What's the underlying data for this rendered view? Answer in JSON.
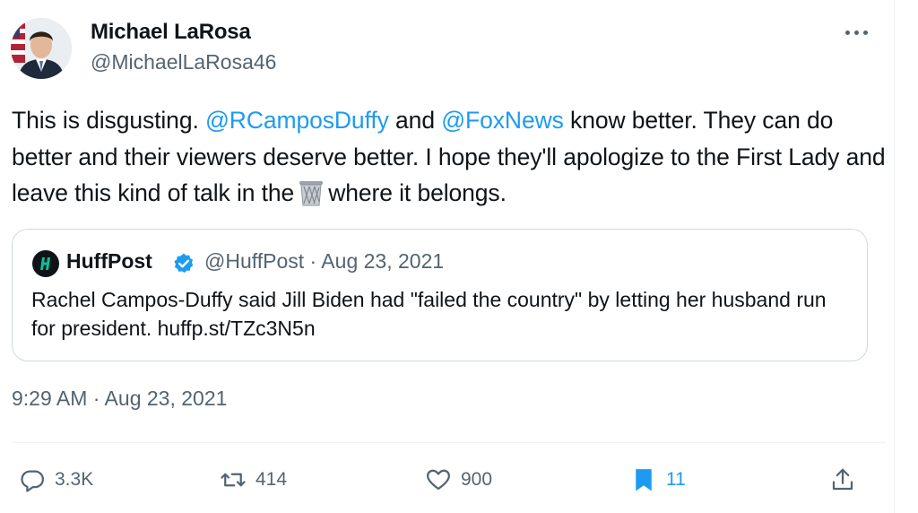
{
  "author": {
    "display_name": "Michael LaRosa",
    "handle": "@MichaelLaRosa46"
  },
  "tweet": {
    "text_1": "This is disgusting. ",
    "mention_1": "@RCamposDuffy",
    "text_2": " and ",
    "mention_2": "@FoxNews",
    "text_3": " know better. They can do better and their viewers deserve better. I hope they'll apologize to the First Lady and leave this kind of talk in the",
    "emoji_name": "wastebasket-emoji",
    "text_4": "where it belongs."
  },
  "quoted_tweet": {
    "author_name": "HuffPost",
    "handle_date": "@HuffPost · Aug 23, 2021",
    "text": "Rachel Campos-Duffy said Jill Biden had \"failed the country\" by letting her husband run for president. huffp.st/TZc3N5n",
    "verified": true
  },
  "timestamp": "9:29 AM · Aug 23, 2021",
  "actions": {
    "replies": "3.3K",
    "retweets": "414",
    "likes": "900",
    "bookmarks": "11"
  },
  "colors": {
    "accent": "#1d9bf0",
    "muted": "#536471",
    "text": "#0f1419",
    "border": "#cfd9de"
  }
}
